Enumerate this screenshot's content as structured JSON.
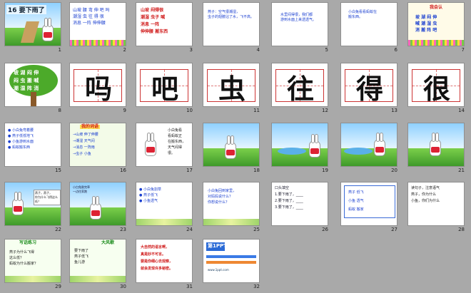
{
  "slides": [
    {
      "n": "1",
      "title": "16 要下雨了"
    },
    {
      "n": "2",
      "lines": [
        "山坡 腰 弯 伸 吧 吗",
        "潮湿 虫 往 得 很",
        "消息 一阵 伸伸腰"
      ]
    },
    {
      "n": "3",
      "lines": [
        "山坡  闷得很",
        "潮湿  虫子  喊",
        "消息  一阵",
        "伸伸腰  搬东西"
      ]
    },
    {
      "n": "4",
      "lines": [
        "燕子：空气很潮湿，",
        "虫子的翅膀沾了水，飞不高。"
      ]
    },
    {
      "n": "5",
      "lines": [
        "水里闷得很，我们都",
        "游到水面上来透透气。"
      ]
    },
    {
      "n": "6",
      "lines": [
        "小白兔看看蚂蚁在",
        "搬东西。"
      ]
    },
    {
      "n": "7",
      "header": "我会认",
      "lines": [
        "坡  湖  闷  伸",
        "喊  潮  湿  虫",
        "消  搬  阵  吧"
      ]
    },
    {
      "n": "8",
      "lines": [
        "坡 湖 闷 伸",
        "闷 虫 搬 喊",
        "潮 湿 阵 消"
      ]
    },
    {
      "n": "9",
      "char": "吗"
    },
    {
      "n": "10",
      "char": "吧"
    },
    {
      "n": "11",
      "char": "虫"
    },
    {
      "n": "12",
      "char": "往"
    },
    {
      "n": "13",
      "char": "得"
    },
    {
      "n": "14",
      "char": "很"
    },
    {
      "n": "15",
      "lines": [
        "● 小白兔弯着腰",
        "● 燕子低低地飞",
        "● 小鱼游到水面",
        "● 蚂蚁搬东西"
      ]
    },
    {
      "n": "16",
      "header": "我的词语",
      "lines": [
        "→山坡  伸了伸腰",
        "→潮湿  天气闷",
        "→消息  一阵雨",
        "→虫子  小鱼"
      ]
    },
    {
      "n": "17",
      "lines": [
        "小白兔看",
        "看蚂蚁正",
        "在搬东西，",
        "天气闷得",
        "很。"
      ]
    },
    {
      "n": "18"
    },
    {
      "n": "19"
    },
    {
      "n": "20"
    },
    {
      "n": "21"
    },
    {
      "n": "22",
      "lines": [
        "燕子，燕子，",
        "你为什么飞得这么低？"
      ]
    },
    {
      "n": "23",
      "lines": [
        "小白兔割完草",
        "一边往家跑"
      ]
    },
    {
      "n": "24",
      "lines": [
        "● 小白兔割草",
        "● 燕子低飞",
        "● 小鱼透气"
      ]
    },
    {
      "n": "25",
      "lines": [
        "小白兔回到家里，",
        "对妈妈说什么？",
        "你想说什么？"
      ]
    },
    {
      "n": "26",
      "lines": [
        "口头填空",
        "1.要下雨了，____",
        "2.要下雨了，____",
        "3.要下雨了，____"
      ]
    },
    {
      "n": "27",
      "lines": [
        "燕子  低飞",
        "小鱼  透气",
        "蚂蚁  搬家"
      ]
    },
    {
      "n": "28",
      "lines": [
        "读句子，注意语气",
        "燕子，你为什么",
        "小鱼，你们为什么"
      ]
    },
    {
      "n": "29",
      "header": "写话练习",
      "lines": [
        "燕子为什么飞得",
        "这么低？",
        "蚂蚁为什么搬家？"
      ]
    },
    {
      "n": "30",
      "header": "大风歌",
      "lines": [
        "要下雨了",
        "燕子低飞",
        "鱼儿游"
      ]
    },
    {
      "n": "31",
      "lines": [
        "大自然的语言啊，",
        "真是妙不可言。",
        "要是你细心去观察，",
        "就会发现许多秘密。"
      ]
    },
    {
      "n": "32",
      "header": "第1PPT",
      "lines": [
        "www.1ppt.com"
      ]
    }
  ],
  "colors": {
    "background": "#a9a9a9",
    "slide_border": "#8f8f8f"
  }
}
